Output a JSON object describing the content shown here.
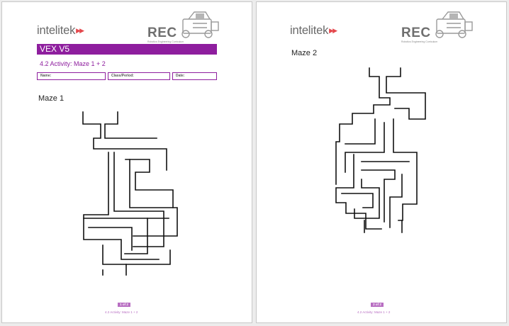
{
  "pages": [
    {
      "logo_text": "intelitek",
      "logo_arrows": "▶▶",
      "rec_text": "REC",
      "rec_subtitle": "Robotics Engineering Curriculum",
      "title": "VEX V5",
      "activity": "4.2 Activity: Maze 1 + 2",
      "fields": {
        "name": "Name:",
        "class_period": "Class/Period:",
        "date": "Date:"
      },
      "maze_heading": "Maze 1",
      "page_number": "1 of 2",
      "footer": "4.2 Activity: Maze 1 + 2"
    },
    {
      "logo_text": "intelitek",
      "logo_arrows": "▶▶",
      "rec_text": "REC",
      "rec_subtitle": "Robotics Engineering Curriculum",
      "maze_heading": "Maze 2",
      "page_number": "2 of 2",
      "footer": "4.2 Activity: Maze 1 + 2"
    }
  ],
  "colors": {
    "brand_purple": "#8e1e9e",
    "footer_purple": "#b86ec2",
    "logo_red": "#e4484d"
  }
}
